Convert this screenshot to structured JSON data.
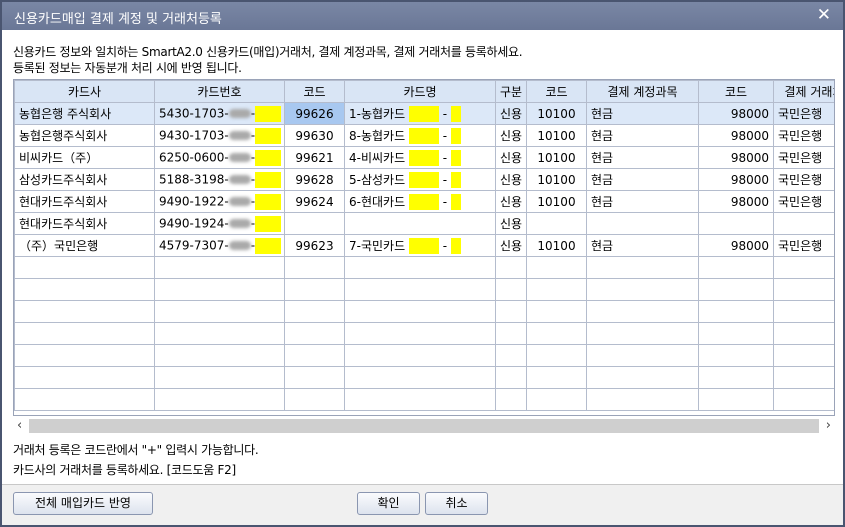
{
  "title": "신용카드매입 결제 계정 및 거래처등록",
  "close_label": "✕",
  "description": [
    "신용카드 정보와 일치하는 SmartA2.0 신용카드(매입)거래처, 결제 계정과목, 결제 거래처를 등록하세요.",
    "등록된 정보는 자동분개 처리 시에 반영 됩니다."
  ],
  "columns": [
    "카드사",
    "카드번호",
    "코드",
    "카드명",
    "구분",
    "코드",
    "결제 계정과목",
    "코드",
    "결제 거래처"
  ],
  "rows": [
    {
      "company": "농협은행 주식회사",
      "card_prefix": "5430-1703-",
      "code": "99626",
      "card_name": "1-농협카드",
      "type": "신용",
      "acct_code": "10100",
      "account": "현금",
      "vendor_code": "98000",
      "vendor": "국민은행"
    },
    {
      "company": "농협은행주식회사",
      "card_prefix": "9430-1703-",
      "code": "99630",
      "card_name": "8-농협카드",
      "type": "신용",
      "acct_code": "10100",
      "account": "현금",
      "vendor_code": "98000",
      "vendor": "국민은행"
    },
    {
      "company": "비씨카드（주）",
      "card_prefix": "6250-0600-",
      "code": "99621",
      "card_name": "4-비씨카드",
      "type": "신용",
      "acct_code": "10100",
      "account": "현금",
      "vendor_code": "98000",
      "vendor": "국민은행"
    },
    {
      "company": "삼성카드주식회사",
      "card_prefix": "5188-3198-",
      "code": "99628",
      "card_name": "5-삼성카드",
      "type": "신용",
      "acct_code": "10100",
      "account": "현금",
      "vendor_code": "98000",
      "vendor": "국민은행"
    },
    {
      "company": "현대카드주식회사",
      "card_prefix": "9490-1922-",
      "code": "99624",
      "card_name": "6-현대카드",
      "type": "신용",
      "acct_code": "10100",
      "account": "현금",
      "vendor_code": "98000",
      "vendor": "국민은행"
    },
    {
      "company": "현대카드주식회사",
      "card_prefix": "9490-1924-",
      "code": "",
      "card_name": "",
      "type": "신용",
      "acct_code": "",
      "account": "",
      "vendor_code": "",
      "vendor": ""
    },
    {
      "company": "（주）국민은행",
      "card_prefix": "4579-7307-",
      "code": "99623",
      "card_name": "7-국민카드",
      "type": "신용",
      "acct_code": "10100",
      "account": "현금",
      "vendor_code": "98000",
      "vendor": "국민은행"
    }
  ],
  "notes": [
    "거래처 등록은 코드란에서 \"+\" 입력시 가능합니다.",
    "카드사의 거래처를 등록하세요. [코드도움 F2]"
  ],
  "buttons": {
    "apply_all": "전체 매입카드 반영",
    "ok": "확인",
    "cancel": "취소"
  },
  "scroll": {
    "left": "‹",
    "right": "›"
  }
}
